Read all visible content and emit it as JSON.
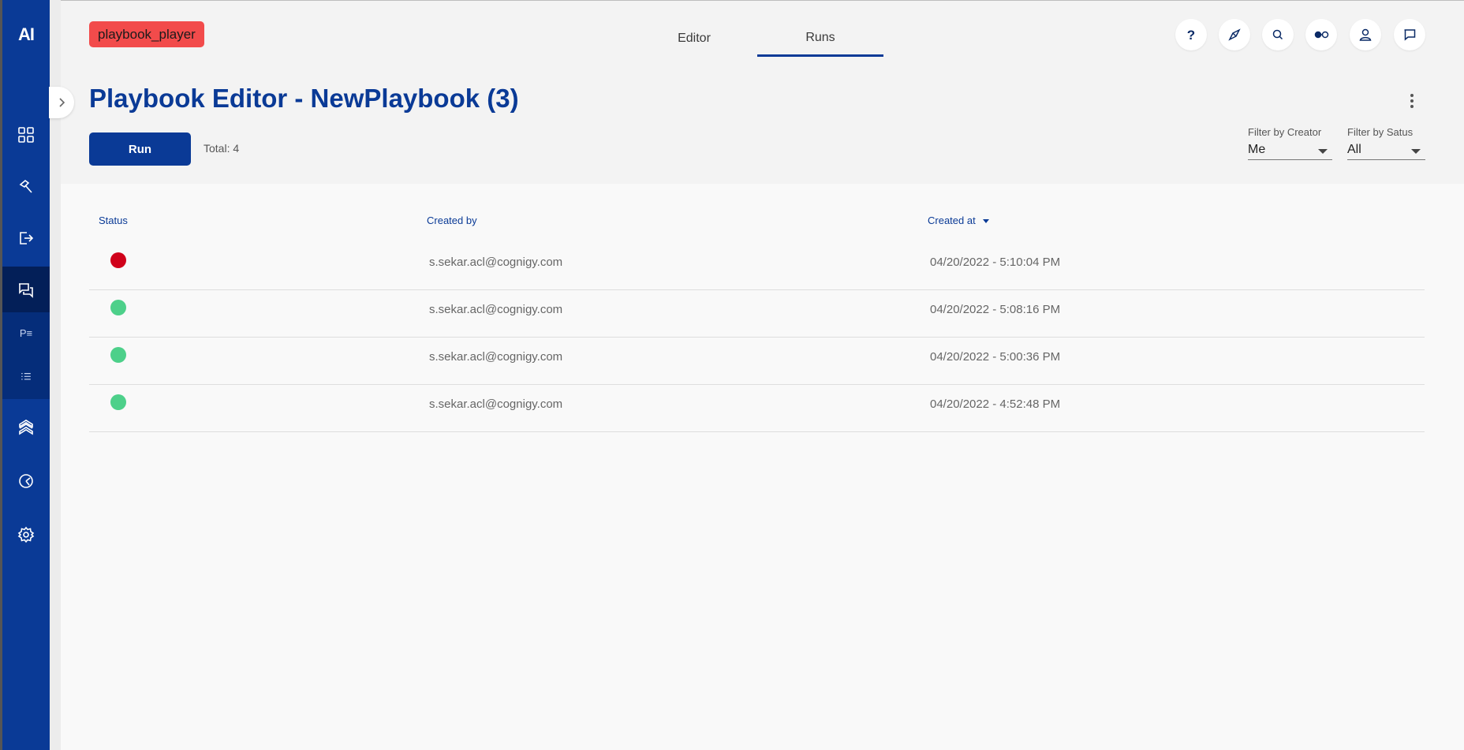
{
  "sidebar": {
    "logo": "AI",
    "items": [
      {
        "name": "dashboard",
        "icon": "grid-icon"
      },
      {
        "name": "build",
        "icon": "hammer-icon"
      },
      {
        "name": "deploy",
        "icon": "logout-icon"
      },
      {
        "name": "test",
        "icon": "chat-icon"
      },
      {
        "name": "playbooks",
        "label": "P≡"
      },
      {
        "name": "runs-list",
        "icon": "list-icon"
      },
      {
        "name": "manage",
        "icon": "layers-icon"
      },
      {
        "name": "analytics",
        "icon": "clock-icon"
      },
      {
        "name": "settings",
        "icon": "gear-icon"
      }
    ]
  },
  "header": {
    "badge": "playbook_player",
    "tabs": [
      {
        "label": "Editor",
        "active": false
      },
      {
        "label": "Runs",
        "active": true
      }
    ],
    "icons": [
      "help-icon",
      "compass-icon",
      "search-icon",
      "toggle-icon",
      "user-icon",
      "chat-icon"
    ]
  },
  "page": {
    "title": "Playbook Editor - NewPlaybook (3)",
    "run_label": "Run",
    "total": "Total: 4"
  },
  "filters": {
    "creator": {
      "label": "Filter by Creator",
      "value": "Me"
    },
    "status": {
      "label": "Filter by Satus",
      "value": "All"
    }
  },
  "table": {
    "headers": {
      "status": "Status",
      "created_by": "Created by",
      "created_at": "Created at"
    },
    "rows": [
      {
        "status": "failed",
        "color": "#d0021b",
        "created_by": "s.sekar.acl@cognigy.com",
        "created_at": "04/20/2022 - 5:10:04 PM"
      },
      {
        "status": "success",
        "color": "#4dd08a",
        "created_by": "s.sekar.acl@cognigy.com",
        "created_at": "04/20/2022 - 5:08:16 PM"
      },
      {
        "status": "success",
        "color": "#4dd08a",
        "created_by": "s.sekar.acl@cognigy.com",
        "created_at": "04/20/2022 - 5:00:36 PM"
      },
      {
        "status": "success",
        "color": "#4dd08a",
        "created_by": "s.sekar.acl@cognigy.com",
        "created_at": "04/20/2022 - 4:52:48 PM"
      }
    ]
  },
  "colors": {
    "brand": "#0a3a96",
    "badge": "#f24b4b"
  }
}
